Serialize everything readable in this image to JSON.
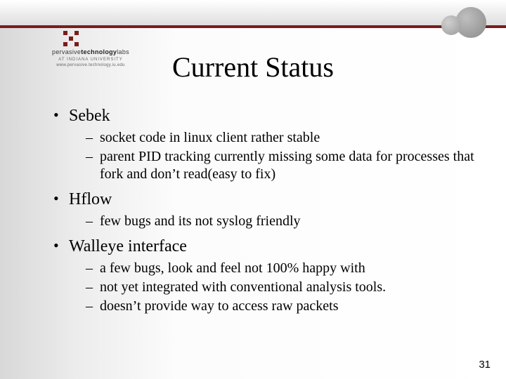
{
  "logo": {
    "line1_a": "pervasive",
    "line1_b": "technology",
    "line1_c": "labs",
    "sub": "AT INDIANA UNIVERSITY",
    "url": "www.pervasive.technology.iu.edu"
  },
  "title": "Current Status",
  "bullets": [
    {
      "text": "Sebek",
      "sub": [
        "socket code in linux client rather stable",
        "parent PID tracking currently missing some data for processes that fork and don’t read(easy to fix)"
      ]
    },
    {
      "text": "Hflow",
      "sub": [
        "few bugs and its not syslog friendly"
      ]
    },
    {
      "text": "Walleye interface",
      "sub": [
        "a few bugs, look and feel not 100% happy with",
        "not yet integrated with conventional analysis tools.",
        "doesn’t provide way to access raw packets"
      ]
    }
  ],
  "page_number": "31"
}
